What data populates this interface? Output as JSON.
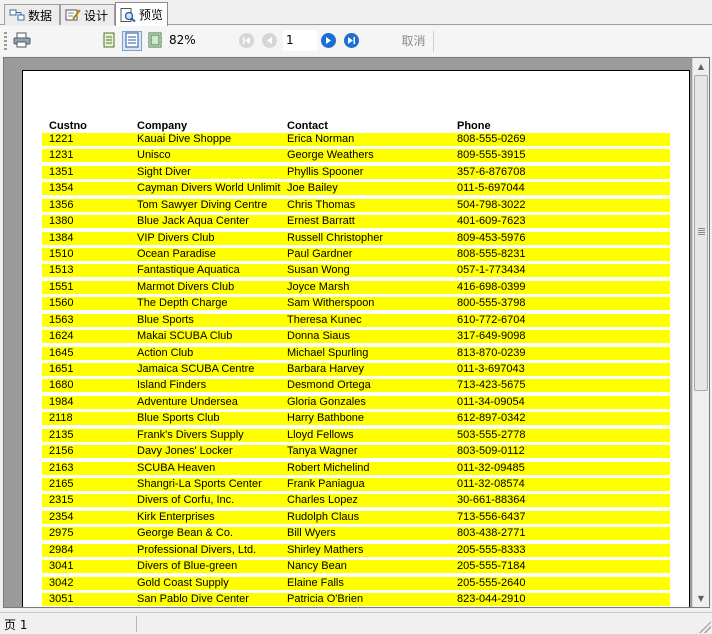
{
  "tabs": [
    {
      "label": "数据",
      "icon": "data-source-icon"
    },
    {
      "label": "设计",
      "icon": "design-icon"
    },
    {
      "label": "预览",
      "icon": "preview-icon"
    }
  ],
  "toolbar": {
    "zoom": "82%",
    "page": "1",
    "cancel_label": "取消"
  },
  "report": {
    "headers": [
      "Custno",
      "Company",
      "Contact",
      "Phone"
    ],
    "row_color": "#ffff00",
    "rows": [
      [
        "1221",
        "Kauai Dive Shoppe",
        "Erica Norman",
        "808-555-0269"
      ],
      [
        "1231",
        "Unisco",
        "George Weathers",
        "809-555-3915"
      ],
      [
        "1351",
        "Sight Diver",
        "Phyllis Spooner",
        "357-6-876708"
      ],
      [
        "1354",
        "Cayman Divers World Unlimited",
        "Joe Bailey",
        "011-5-697044"
      ],
      [
        "1356",
        "Tom Sawyer Diving Centre",
        "Chris Thomas",
        "504-798-3022"
      ],
      [
        "1380",
        "Blue Jack Aqua Center",
        "Ernest Barratt",
        "401-609-7623"
      ],
      [
        "1384",
        "VIP Divers Club",
        "Russell Christopher",
        "809-453-5976"
      ],
      [
        "1510",
        "Ocean Paradise",
        "Paul Gardner",
        "808-555-8231"
      ],
      [
        "1513",
        "Fantastique Aquatica",
        "Susan Wong",
        "057-1-773434"
      ],
      [
        "1551",
        "Marmot Divers Club",
        "Joyce Marsh",
        "416-698-0399"
      ],
      [
        "1560",
        "The Depth Charge",
        "Sam Witherspoon",
        "800-555-3798"
      ],
      [
        "1563",
        "Blue Sports",
        "Theresa Kunec",
        "610-772-6704"
      ],
      [
        "1624",
        "Makai SCUBA Club",
        "Donna Siaus",
        "317-649-9098"
      ],
      [
        "1645",
        "Action Club",
        "Michael Spurling",
        "813-870-0239"
      ],
      [
        "1651",
        "Jamaica SCUBA Centre",
        "Barbara Harvey",
        "011-3-697043"
      ],
      [
        "1680",
        "Island Finders",
        "Desmond Ortega",
        "713-423-5675"
      ],
      [
        "1984",
        "Adventure Undersea",
        "Gloria Gonzales",
        "011-34-09054"
      ],
      [
        "2118",
        "Blue Sports Club",
        "Harry Bathbone",
        "612-897-0342"
      ],
      [
        "2135",
        "Frank's Divers Supply",
        "Lloyd Fellows",
        "503-555-2778"
      ],
      [
        "2156",
        "Davy Jones' Locker",
        "Tanya Wagner",
        "803-509-0112"
      ],
      [
        "2163",
        "SCUBA Heaven",
        "Robert Michelind",
        "011-32-09485"
      ],
      [
        "2165",
        "Shangri-La Sports Center",
        "Frank Paniagua",
        "011-32-08574"
      ],
      [
        "2315",
        "Divers of Corfu, Inc.",
        "Charles Lopez",
        "30-661-88364"
      ],
      [
        "2354",
        "Kirk Enterprises",
        "Rudolph Claus",
        "713-556-6437"
      ],
      [
        "2975",
        "George Bean & Co.",
        "Bill Wyers",
        "803-438-2771"
      ],
      [
        "2984",
        "Professional Divers, Ltd.",
        "Shirley Mathers",
        "205-555-8333"
      ],
      [
        "3041",
        "Divers of Blue-green",
        "Nancy Bean",
        "205-555-7184"
      ],
      [
        "3042",
        "Gold Coast Supply",
        "Elaine Falls",
        "205-555-2640"
      ],
      [
        "3051",
        "San Pablo Dive Center",
        "Patricia O'Brien",
        "823-044-2910"
      ]
    ]
  },
  "status": {
    "page_label": "页 1"
  }
}
